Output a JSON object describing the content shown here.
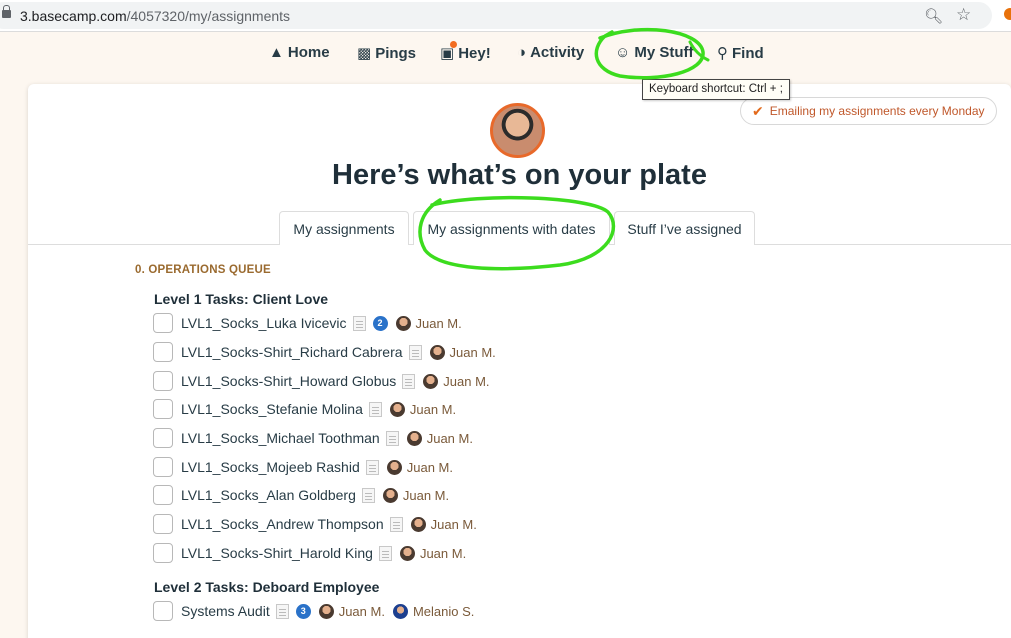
{
  "browser": {
    "url_host": "3.basecamp.com",
    "url_path": "/4057320/my/assignments"
  },
  "nav": {
    "home": "Home",
    "pings": "Pings",
    "hey": "Hey!",
    "activity": "Activity",
    "my_stuff": "My Stuff",
    "find": "Find"
  },
  "tooltip": "Keyboard shortcut: Ctrl + ;",
  "email_button": "Emailing my assignments every Monday",
  "heading": "Here’s what’s on your plate",
  "tabs": [
    "My assignments",
    "My assignments with dates",
    "Stuff I’ve assigned"
  ],
  "section": "0. OPERATIONS QUEUE",
  "groups": [
    {
      "title": "Level 1 Tasks: Client Love",
      "todos": [
        {
          "title": "LVL1_Socks_Luka Ivicevic",
          "count": "2",
          "assignees": [
            "Juan M."
          ]
        },
        {
          "title": "LVL1_Socks-Shirt_Richard Cabrera",
          "assignees": [
            "Juan M."
          ]
        },
        {
          "title": "LVL1_Socks-Shirt_Howard Globus",
          "assignees": [
            "Juan M."
          ]
        },
        {
          "title": "LVL1_Socks_Stefanie Molina",
          "assignees": [
            "Juan M."
          ]
        },
        {
          "title": "LVL1_Socks_Michael Toothman",
          "assignees": [
            "Juan M."
          ]
        },
        {
          "title": "LVL1_Socks_Mojeeb Rashid",
          "assignees": [
            "Juan M."
          ]
        },
        {
          "title": "LVL1_Socks_Alan Goldberg",
          "assignees": [
            "Juan M."
          ]
        },
        {
          "title": "LVL1_Socks_Andrew Thompson",
          "assignees": [
            "Juan M."
          ]
        },
        {
          "title": "LVL1_Socks-Shirt_Harold King",
          "assignees": [
            "Juan M."
          ]
        }
      ]
    },
    {
      "title": "Level 2 Tasks: Deboard Employee",
      "todos": [
        {
          "title": "Systems Audit",
          "count": "3",
          "assignees": [
            "Juan M.",
            "Melanio S."
          ]
        }
      ]
    }
  ]
}
